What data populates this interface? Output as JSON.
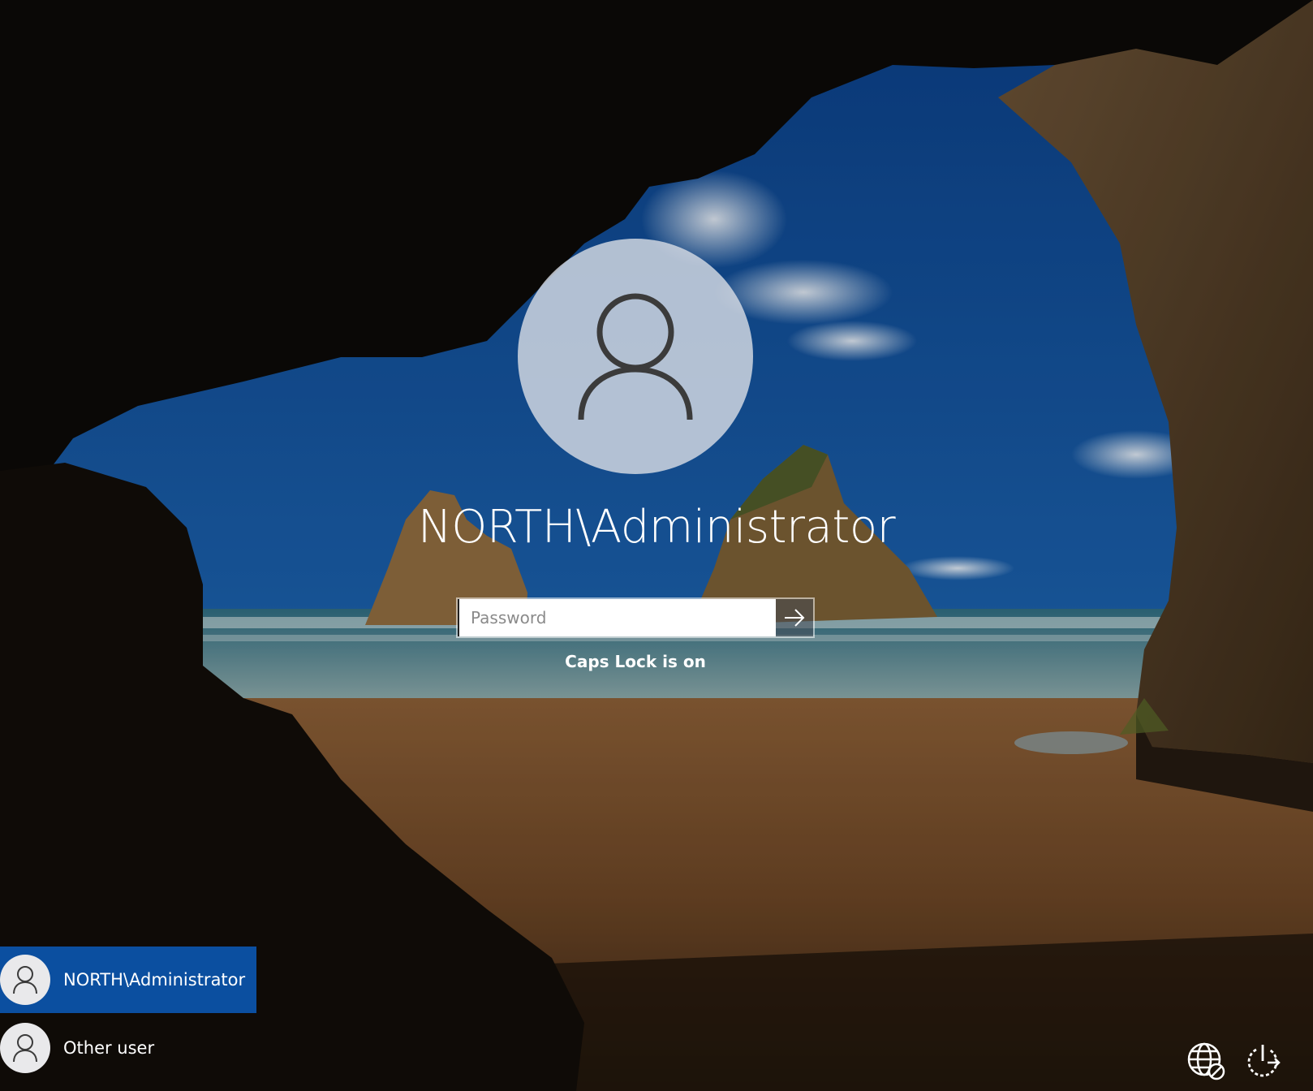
{
  "login": {
    "user_name": "NORTH\\Administrator",
    "password_placeholder": "Password",
    "password_value": "",
    "caps_lock_warning": "Caps Lock is on"
  },
  "user_list": [
    {
      "label": "NORTH\\Administrator",
      "selected": true
    },
    {
      "label": "Other user",
      "selected": false
    }
  ],
  "icons": {
    "avatar": "user-icon",
    "submit": "arrow-right-icon",
    "network": "globe-network-icon",
    "power": "power-icon"
  },
  "colors": {
    "selected_tile": "#0b4fa0",
    "text": "#ffffff"
  }
}
